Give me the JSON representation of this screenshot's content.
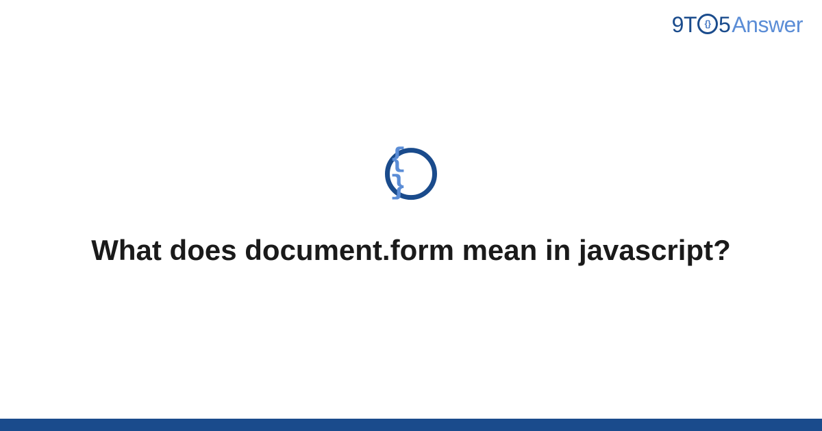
{
  "logo": {
    "part1": "9T",
    "circle_inner": "{}",
    "part2": "5",
    "part3": "Answer"
  },
  "icon": {
    "braces": "{ }"
  },
  "question": {
    "title": "What does document.form mean in javascript?"
  },
  "colors": {
    "primary": "#1a4b8c",
    "accent": "#5b8dd6",
    "text": "#1a1a1a",
    "background": "#ffffff"
  }
}
